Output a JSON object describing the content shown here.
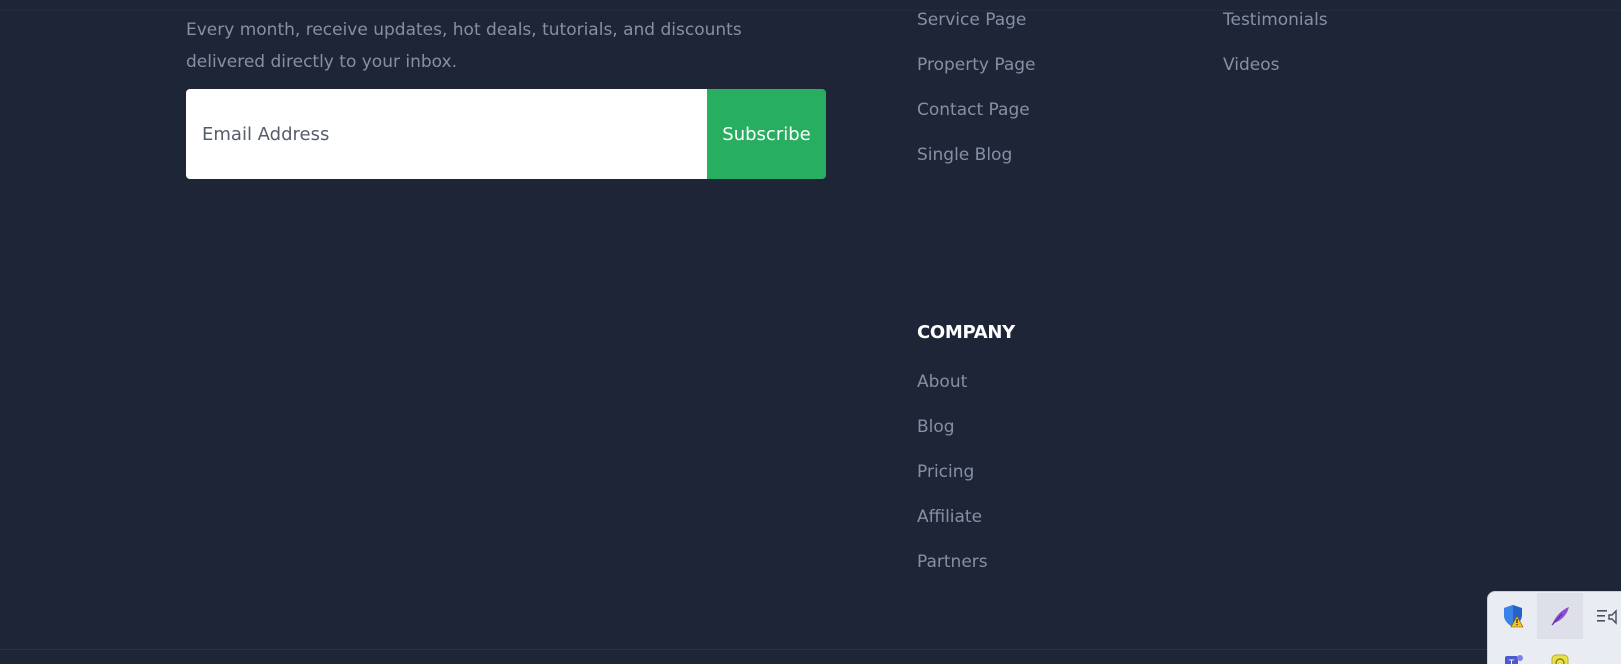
{
  "newsletter": {
    "description": "Every month, receive updates, hot deals, tutorials, and discounts delivered directly to your inbox.",
    "email_placeholder": "Email Address",
    "subscribe_label": "Subscribe"
  },
  "pages_links_left": [
    {
      "label": "Service Page"
    },
    {
      "label": "Property Page"
    },
    {
      "label": "Contact Page"
    },
    {
      "label": "Single Blog"
    }
  ],
  "pages_links_right": [
    {
      "label": "Testimonials"
    },
    {
      "label": "Videos"
    }
  ],
  "company": {
    "heading": "COMPANY",
    "links": [
      {
        "label": "About"
      },
      {
        "label": "Blog"
      },
      {
        "label": "Pricing"
      },
      {
        "label": "Affiliate"
      },
      {
        "label": "Partners"
      }
    ]
  },
  "colors": {
    "background": "#1d2537",
    "link_text": "#8590a6",
    "accent_green": "#27ae60",
    "heading_text": "#ffffff"
  },
  "tray_icons": [
    "security-shield-warning-icon",
    "feather-pen-icon",
    "speaker-list-icon",
    "teams-icon",
    "yellow-app-icon"
  ]
}
